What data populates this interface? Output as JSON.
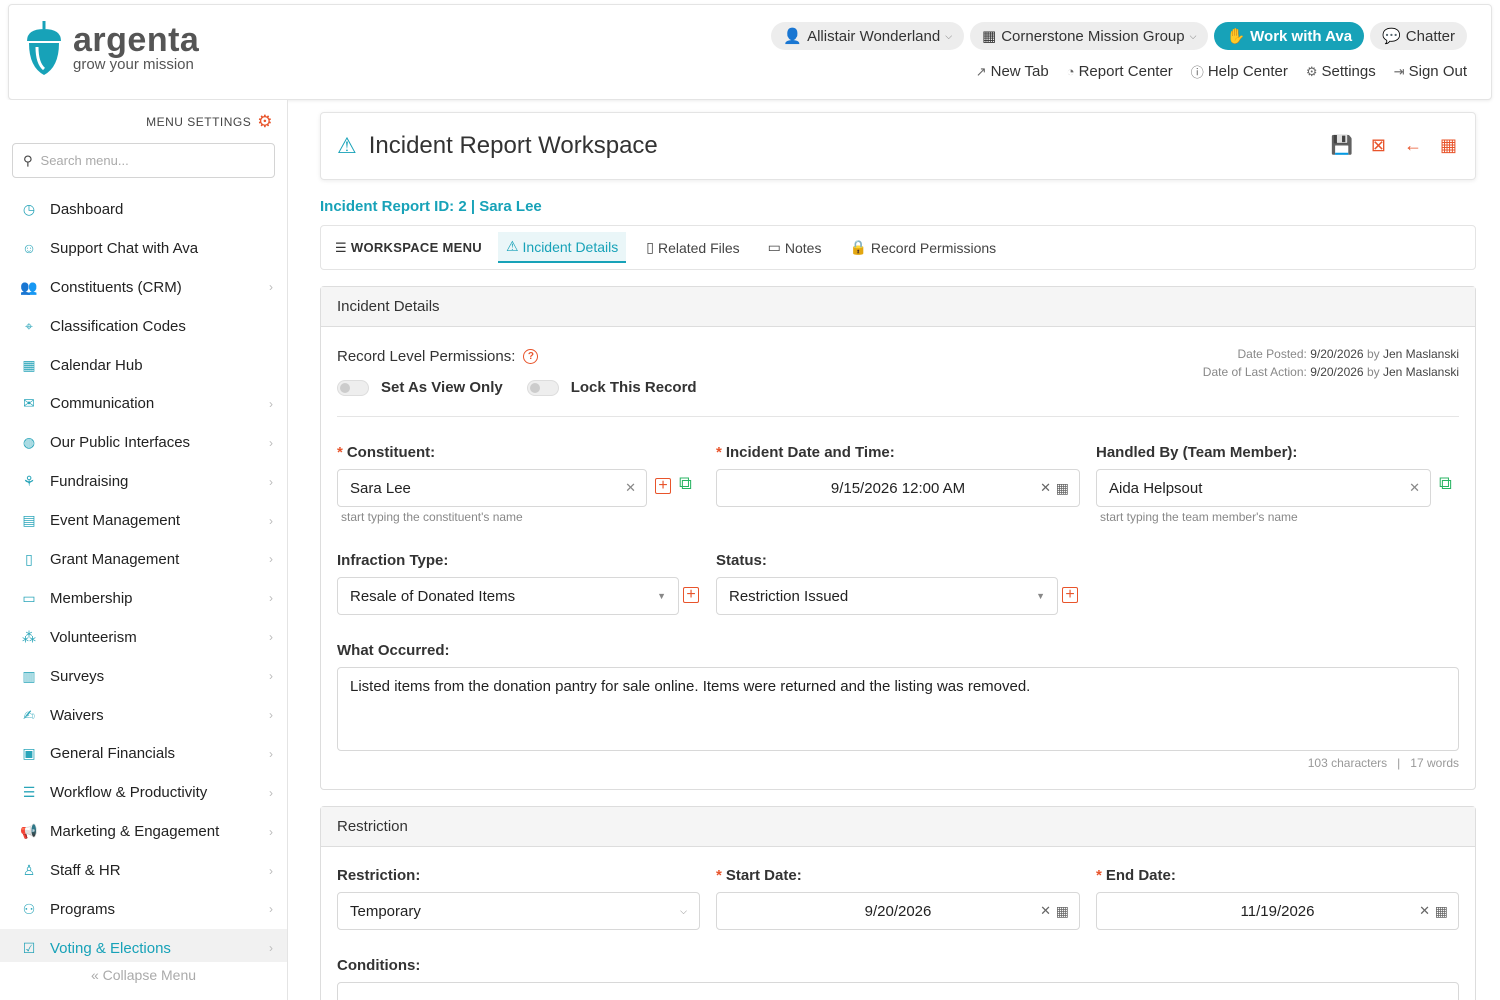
{
  "header": {
    "brand_name": "argenta",
    "brand_tagline": "grow your mission",
    "user": "Allistair Wonderland",
    "org": "Cornerstone Mission Group",
    "ava_button": "Work with Ava",
    "chatter": "Chatter",
    "links": [
      "New Tab",
      "Report Center",
      "Help Center",
      "Settings",
      "Sign Out"
    ]
  },
  "sidebar": {
    "menu_settings": "MENU SETTINGS",
    "search_placeholder": "Search menu...",
    "items": [
      {
        "label": "Dashboard",
        "icon": "dashboard-icon"
      },
      {
        "label": "Support Chat with Ava",
        "icon": "robot-icon"
      },
      {
        "label": "Constituents (CRM)",
        "icon": "people-icon"
      },
      {
        "label": "Classification Codes",
        "icon": "tag-icon"
      },
      {
        "label": "Calendar Hub",
        "icon": "calendar-icon"
      },
      {
        "label": "Communication",
        "icon": "envelope-icon"
      },
      {
        "label": "Our Public Interfaces",
        "icon": "globe-icon"
      },
      {
        "label": "Fundraising",
        "icon": "hand-coin-icon"
      },
      {
        "label": "Event Management",
        "icon": "event-icon"
      },
      {
        "label": "Grant Management",
        "icon": "grant-icon"
      },
      {
        "label": "Membership",
        "icon": "id-card-icon"
      },
      {
        "label": "Volunteerism",
        "icon": "volunteer-icon"
      },
      {
        "label": "Surveys",
        "icon": "survey-icon"
      },
      {
        "label": "Waivers",
        "icon": "signature-icon"
      },
      {
        "label": "General Financials",
        "icon": "money-icon"
      },
      {
        "label": "Workflow & Productivity",
        "icon": "checklist-icon"
      },
      {
        "label": "Marketing & Engagement",
        "icon": "megaphone-icon"
      },
      {
        "label": "Staff & HR",
        "icon": "staff-icon"
      },
      {
        "label": "Programs",
        "icon": "programs-icon"
      },
      {
        "label": "Voting & Elections",
        "icon": "ballot-icon"
      }
    ],
    "collapse": "Collapse Menu"
  },
  "main": {
    "title": "Incident Report Workspace",
    "record_id": "Incident Report ID: 2 | Sara Lee",
    "workspace_menu": "WORKSPACE MENU",
    "tabs": [
      "Incident Details",
      "Related Files",
      "Notes",
      "Record Permissions"
    ],
    "details": {
      "heading": "Incident Details",
      "record_perms_label": "Record Level Permissions:",
      "view_only": "Set As View Only",
      "lock_record": "Lock This Record",
      "date_posted_label": "Date Posted:",
      "date_posted": "9/20/2026",
      "by1": "by",
      "posted_by": "Jen Maslanski",
      "last_action_label": "Date of Last Action:",
      "last_action": "9/20/2026",
      "by2": "by",
      "last_action_by": "Jen Maslanski",
      "constituent_label": "Constituent:",
      "constituent_value": "Sara Lee",
      "constituent_hint": "start typing the constituent's name",
      "incident_dt_label": "Incident Date and Time:",
      "incident_dt_value": "9/15/2026 12:00 AM",
      "handled_by_label": "Handled By (Team Member):",
      "handled_by_value": "Aida Helpsout",
      "handled_by_hint": "start typing the team member's name",
      "infraction_label": "Infraction Type:",
      "infraction_value": "Resale of Donated Items",
      "status_label": "Status:",
      "status_value": "Restriction Issued",
      "what_label": "What Occurred:",
      "what_value": "Listed items from the donation pantry for sale online. Items were returned and the listing was removed.",
      "char_count": "103 characters",
      "sep": "|",
      "word_count": "17 words"
    },
    "restriction": {
      "heading": "Restriction",
      "restriction_label": "Restriction:",
      "restriction_value": "Temporary",
      "start_label": "Start Date:",
      "start_value": "9/20/2026",
      "end_label": "End Date:",
      "end_value": "11/19/2026",
      "conditions_label": "Conditions:"
    }
  },
  "colors": {
    "accent": "#17a2b8",
    "action": "#e8542b",
    "external": "#28b463"
  }
}
